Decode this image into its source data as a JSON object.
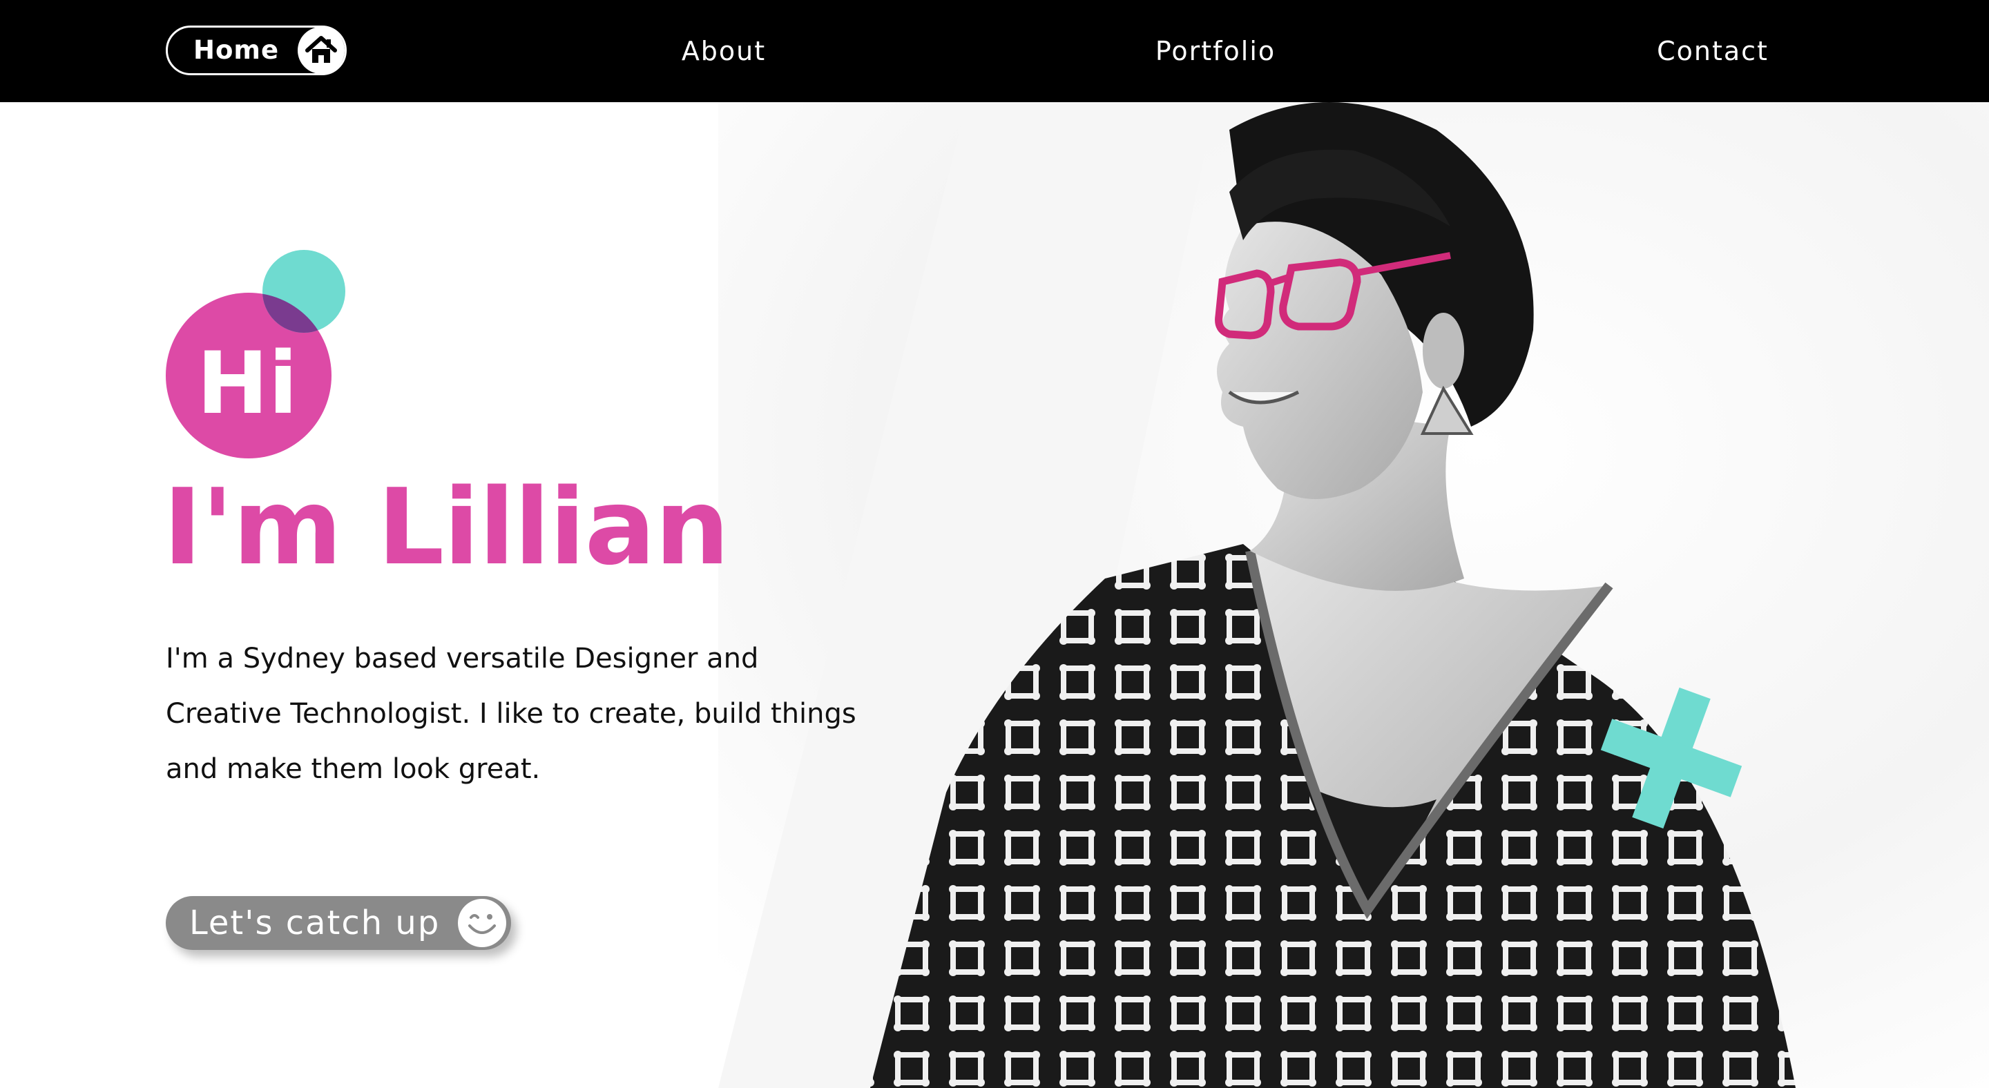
{
  "nav": {
    "home_label": "Home",
    "home_icon": "house-icon",
    "about_label": "About",
    "portfolio_label": "Portfolio",
    "contact_label": "Contact"
  },
  "hero": {
    "badge_text": "Hi",
    "name_heading": "I'm Lillian",
    "intro": "I'm a Sydney based versatile Designer and Creative Technologist. I like to create, build things and make them look great.",
    "cta_label": "Let's catch up",
    "cta_icon": "winking-smiley-icon"
  },
  "colors": {
    "brand_pink": "#dd4aa6",
    "accent_teal": "#6fdbd0",
    "nav_background": "#000000",
    "cta_background": "#8a8a8a"
  }
}
